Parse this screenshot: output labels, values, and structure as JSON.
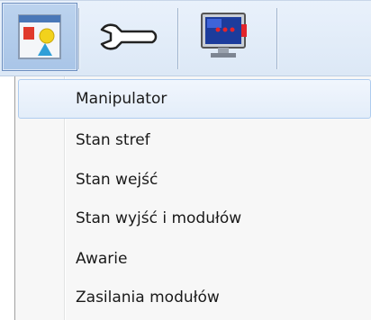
{
  "toolbar": {
    "buttons": [
      {
        "icon": "window-shapes-icon",
        "active": true
      },
      {
        "icon": "wrench-icon",
        "active": false
      },
      {
        "icon": "monitor-diagnostics-icon",
        "active": false
      }
    ]
  },
  "menu": {
    "items": [
      {
        "label": "Manipulator"
      },
      {
        "label": "Stan stref"
      },
      {
        "label": "Stan wejść"
      },
      {
        "label": "Stan wyjść i modułów"
      },
      {
        "label": "Awarie"
      },
      {
        "label": "Zasilania modułów"
      }
    ]
  }
}
